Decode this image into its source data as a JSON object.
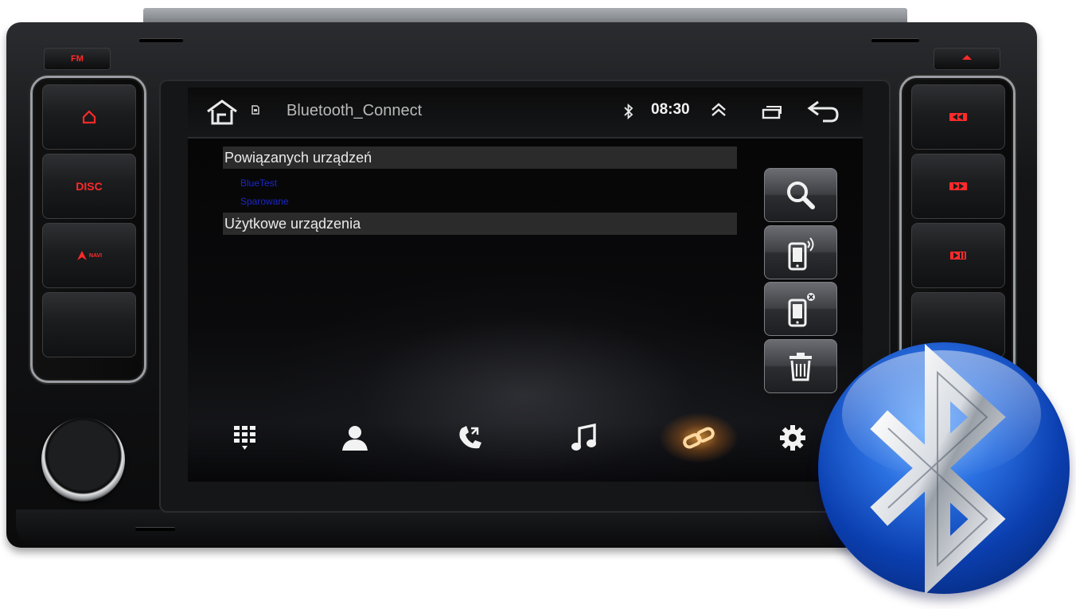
{
  "hardware": {
    "fm_label": "FM",
    "disc_label": "DISC",
    "navi_label": "NAVI",
    "eject_icon": "eject-icon",
    "left_buttons": [
      "home-icon",
      "DISC",
      "navi-icon",
      ""
    ],
    "right_buttons": [
      "prev-track-icon",
      "next-track-icon",
      "play-pause-icon",
      ""
    ]
  },
  "status_bar": {
    "home_icon": "home-icon",
    "sd_icon": "sd-card-icon",
    "title": "Bluetooth_Connect",
    "bluetooth_icon": "bluetooth-icon",
    "time": "08:30",
    "collapse_icon": "double-chevron-up-icon",
    "recents_icon": "recent-apps-icon",
    "back_icon": "back-icon"
  },
  "paired": {
    "header": "Powiązanych urządzeń",
    "device_name": "BlueTest",
    "device_status": "Sparowane"
  },
  "available": {
    "header": "Użytkowe urządzenia"
  },
  "side_actions": [
    "search-icon",
    "phone-connect-icon",
    "phone-disconnect-icon",
    "trash-icon"
  ],
  "bottom_nav": {
    "items": [
      "dialpad-icon",
      "contacts-icon",
      "call-log-icon",
      "music-icon",
      "link-icon",
      "settings-icon"
    ],
    "active_index": 4
  },
  "colors": {
    "hardware_accent": "#ff2a2a",
    "paired_device_text": "#1c27c8",
    "active_glow": "#ffa53c",
    "badge_blue": "#0b3fb0"
  }
}
